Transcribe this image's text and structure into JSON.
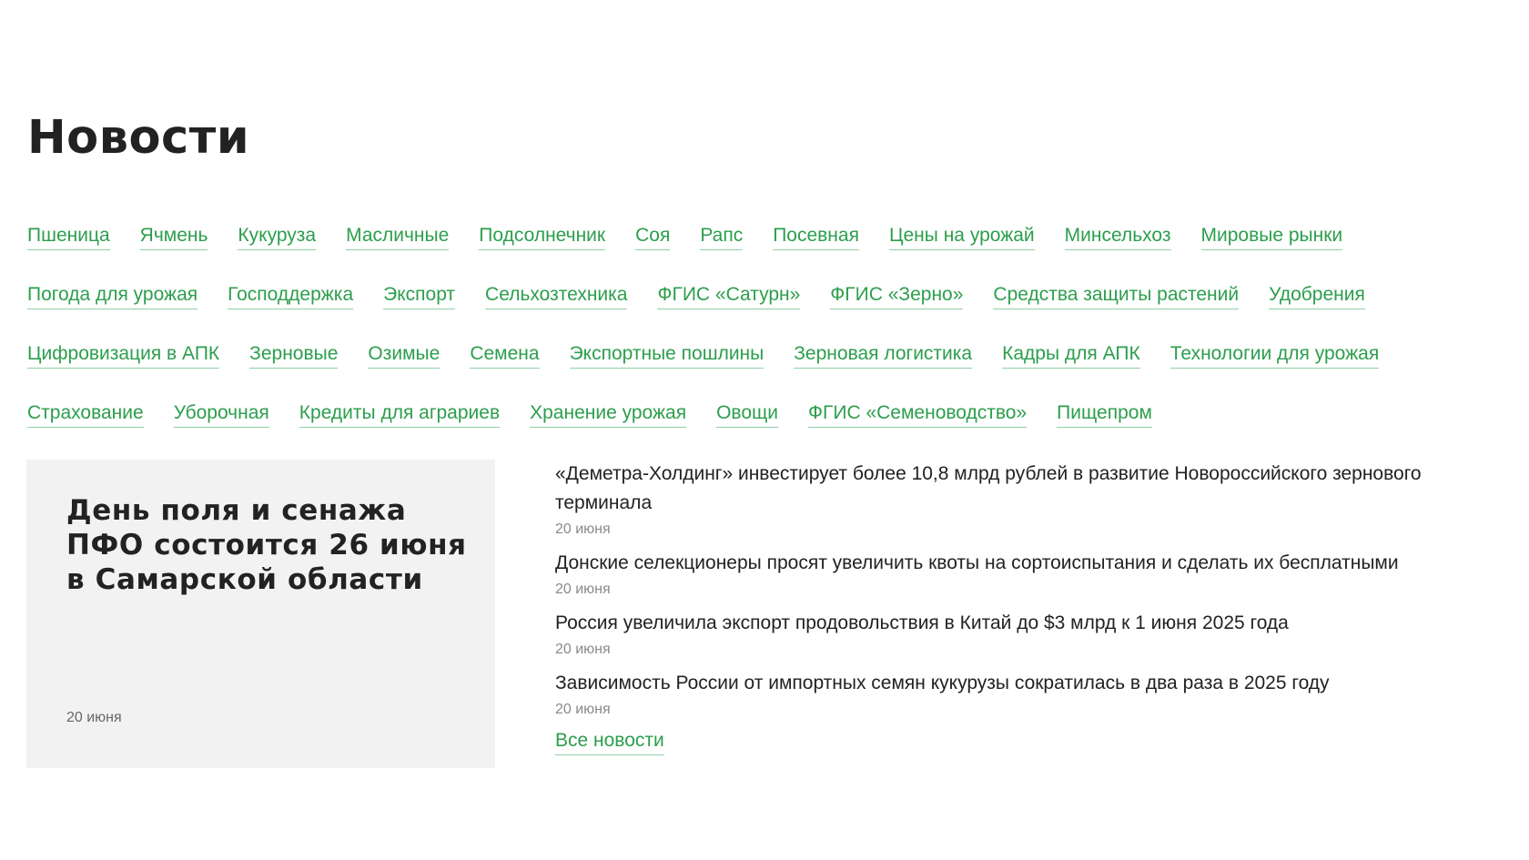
{
  "page": {
    "title": "Новости",
    "accent_color": "#2c9e4d"
  },
  "tags": [
    "Пшеница",
    "Ячмень",
    "Кукуруза",
    "Масличные",
    "Подсолнечник",
    "Соя",
    "Рапс",
    "Посевная",
    "Цены на урожай",
    "Минсельхоз",
    "Мировые рынки",
    "Погода для урожая",
    "Господдержка",
    "Экспорт",
    "Сельхозтехника",
    "ФГИС «Сатурн»",
    "ФГИС «Зерно»",
    "Средства защиты растений",
    "Удобрения",
    "Цифровизация в АПК",
    "Зерновые",
    "Озимые",
    "Семена",
    "Экспортные пошлины",
    "Зерновая логистика",
    "Кадры для АПК",
    "Технологии для урожая",
    "Страхование",
    "Уборочная",
    "Кредиты для аграриев",
    "Хранение урожая",
    "Овощи",
    "ФГИС «Семеноводство»",
    "Пищепром"
  ],
  "feature": {
    "title": "День поля и сенажа ПФО состоится 26 июня в Самарской области",
    "date": "20 июня"
  },
  "news": [
    {
      "title": "«Деметра-Холдинг» инвестирует более 10,8 млрд рублей в развитие Новороссийского зернового терминала",
      "date": "20 июня"
    },
    {
      "title": "Донские селекционеры просят увеличить квоты на сортоиспытания и сделать их бесплатными",
      "date": "20 июня"
    },
    {
      "title": "Россия увеличила экспорт продовольствия в Китай до $3 млрд к 1 июня 2025 года",
      "date": "20 июня"
    },
    {
      "title": "Зависимость России от импортных семян кукурузы сократилась в два раза в 2025 году",
      "date": "20 июня"
    }
  ],
  "all_news_label": "Все новости"
}
